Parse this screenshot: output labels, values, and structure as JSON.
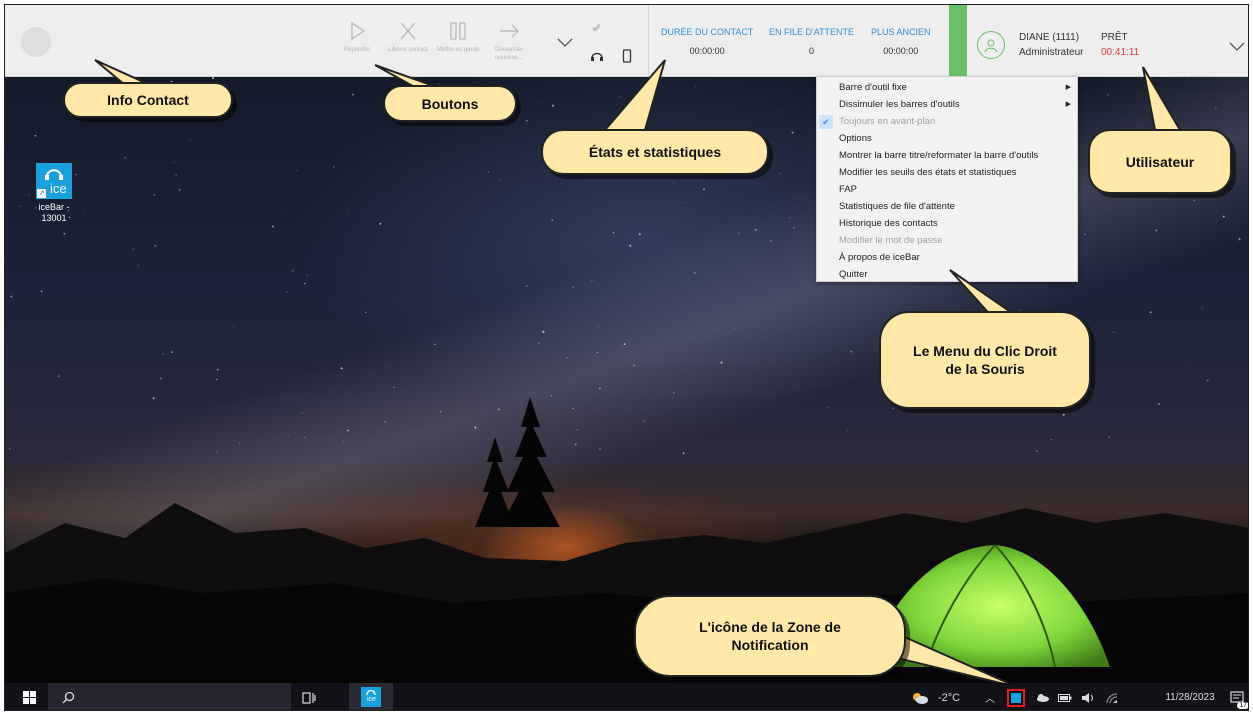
{
  "toolbar": {
    "buttons": [
      {
        "label": "Répondre",
        "icon": "play-icon"
      },
      {
        "label": "Libérer contact",
        "icon": "close-icon"
      },
      {
        "label": "Mettre en garde",
        "icon": "pause-icon"
      },
      {
        "label": "Demander nouveau...",
        "icon": "arrow-right-icon"
      }
    ],
    "stats": [
      {
        "label": "DURÉE DU CONTACT",
        "value": "00:00:00"
      },
      {
        "label": "EN FILE D'ATTENTE",
        "value": "0"
      },
      {
        "label": "PLUS ANCIEN",
        "value": "00:00:00"
      }
    ],
    "user": {
      "name": "DIANE (1111)",
      "role": "Administrateur"
    },
    "state": {
      "label": "PRÊT",
      "timer": "00:41:11"
    }
  },
  "context_menu": [
    {
      "label": "Barre d'outil fixe",
      "submenu": true
    },
    {
      "label": "Dissimuler les barres d'outils",
      "submenu": true
    },
    {
      "label": "Toujours en avant-plan",
      "checked": true,
      "disabled": true
    },
    {
      "label": "Options"
    },
    {
      "label": "Montrer la barre titre/reformater la barre d'outils"
    },
    {
      "label": "Modifier les seuils des états et statistiques"
    },
    {
      "label": "FAP"
    },
    {
      "label": "Statistiques de file d'attente"
    },
    {
      "label": "Historique des contacts"
    },
    {
      "label": "Modifier le mot de passe",
      "disabled": true
    },
    {
      "label": "À propos de iceBar"
    },
    {
      "label": "Quitter"
    }
  ],
  "desktop_icon": {
    "tile_text": "ice",
    "caption": "iceBar - 13001"
  },
  "callouts": {
    "info_contact": "Info Contact",
    "boutons": "Boutons",
    "etats": "États et statistiques",
    "utilisateur": "Utilisateur",
    "menu": "Le Menu du Clic Droit de la Souris",
    "notification": "L'icône de la Zone de Notification"
  },
  "taskbar": {
    "weather": "-2°C",
    "date": "11/28/2023",
    "notification_count": "17",
    "ice_tile_text": "ice"
  },
  "colors": {
    "accent_blue": "#2d8fd6",
    "status_green": "#6bbf6b",
    "timer_red": "#e23b3b",
    "callout_fill": "#ffe8a8"
  }
}
